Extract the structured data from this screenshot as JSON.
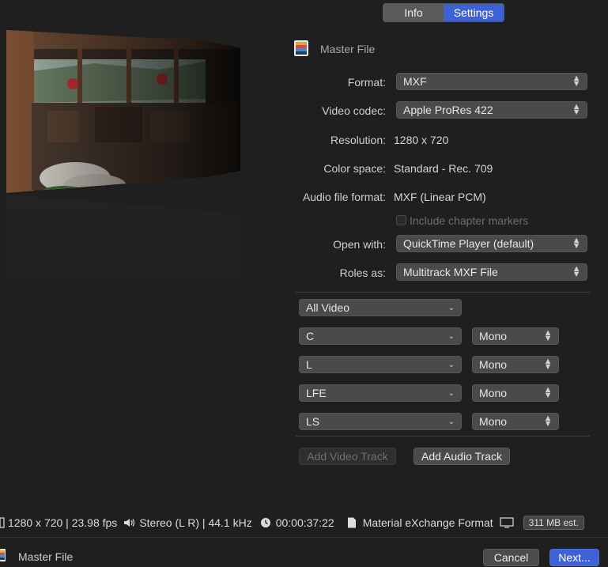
{
  "tabs": [
    {
      "label": "Info",
      "active": false
    },
    {
      "label": "Settings",
      "active": true
    }
  ],
  "header": {
    "title": "Master File",
    "icon": "film-icon"
  },
  "settings": {
    "format": {
      "label": "Format:",
      "value": "MXF"
    },
    "video_codec": {
      "label": "Video codec:",
      "value": "Apple ProRes 422"
    },
    "resolution": {
      "label": "Resolution:",
      "value": "1280 x 720"
    },
    "color_space": {
      "label": "Color space:",
      "value": "Standard - Rec. 709"
    },
    "audio_format": {
      "label": "Audio file format:",
      "value": "MXF (Linear PCM)"
    },
    "chapter_markers": {
      "label": "Include chapter markers",
      "checked": false,
      "enabled": false
    },
    "open_with": {
      "label": "Open with:",
      "value": "QuickTime Player (default)"
    },
    "roles_as": {
      "label": "Roles as:",
      "value": "Multitrack MXF File"
    }
  },
  "tracks": {
    "video": {
      "value": "All Video"
    },
    "audio": [
      {
        "role": "C",
        "channel": "Mono"
      },
      {
        "role": "L",
        "channel": "Mono"
      },
      {
        "role": "LFE",
        "channel": "Mono"
      },
      {
        "role": "LS",
        "channel": "Mono"
      }
    ],
    "add_video_label": "Add Video Track",
    "add_audio_label": "Add Audio Track"
  },
  "status": {
    "resolution_fps": "1280 x 720 | 23.98 fps",
    "audio": "Stereo (L R) | 44.1 kHz",
    "duration": "00:00:37:22",
    "format": "Material eXchange Format",
    "size": "311 MB est."
  },
  "footer": {
    "title": "Master File",
    "cancel_label": "Cancel",
    "next_label": "Next..."
  },
  "colors": {
    "accent": "#3e62d6",
    "background": "#1f1f1f"
  }
}
